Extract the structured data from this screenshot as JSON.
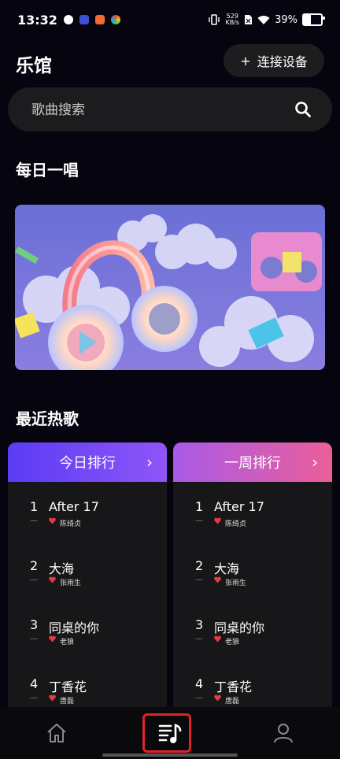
{
  "status_bar": {
    "time": "13:32",
    "net_speed_value": "529",
    "net_speed_unit": "KB/s",
    "battery": "39%",
    "battery_level": 0.39
  },
  "header": {
    "title": "乐馆",
    "connect_label": "连接设备",
    "connect_icon": "+"
  },
  "search": {
    "placeholder": "歌曲搜索"
  },
  "sections": {
    "daily": "每日一唱",
    "hot": "最近热歌"
  },
  "rankings": [
    {
      "title": "今日排行",
      "gradient": [
        "#5b3cf5",
        "#8f55f8"
      ],
      "songs": [
        {
          "rank": "1",
          "title": "After 17",
          "artist": "陈绮贞"
        },
        {
          "rank": "2",
          "title": "大海",
          "artist": "张雨生"
        },
        {
          "rank": "3",
          "title": "同桌的你",
          "artist": "老狼"
        },
        {
          "rank": "4",
          "title": "丁香花",
          "artist": "唐磊"
        }
      ]
    },
    {
      "title": "一周排行",
      "gradient": [
        "#a95ae8",
        "#ea5f99"
      ],
      "songs": [
        {
          "rank": "1",
          "title": "After 17",
          "artist": "陈绮贞"
        },
        {
          "rank": "2",
          "title": "大海",
          "artist": "张雨生"
        },
        {
          "rank": "3",
          "title": "同桌的你",
          "artist": "老狼"
        },
        {
          "rank": "4",
          "title": "丁香花",
          "artist": "唐磊"
        }
      ]
    }
  ],
  "song_dash": "—",
  "colors": {
    "background": "#06040f",
    "heart": "#e53946",
    "highlight": "#e0222a"
  },
  "nav": [
    {
      "icon": "home-icon",
      "selected": false
    },
    {
      "icon": "music-list-icon",
      "selected": true
    },
    {
      "icon": "profile-icon",
      "selected": false
    }
  ]
}
